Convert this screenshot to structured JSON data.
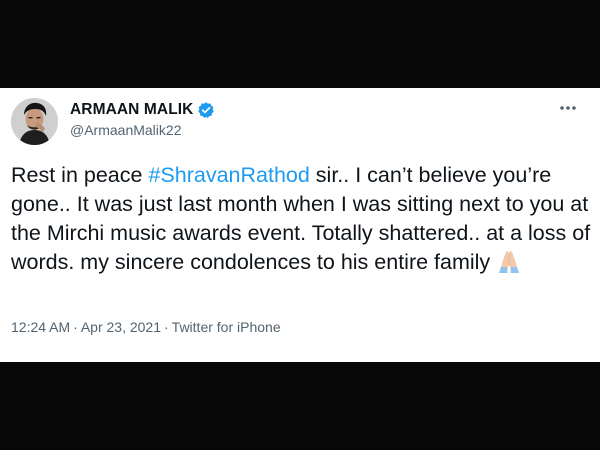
{
  "tweet": {
    "author": {
      "display_name": "ARMAAN MALIK",
      "handle": "@ArmaanMalik22",
      "verified": true
    },
    "more_icon": "more-options-icon",
    "text": {
      "before_hashtag": "Rest in peace ",
      "hashtag": "#ShravanRathod",
      "after_hashtag": " sir.. I can’t believe you’re gone.. It was just last month when I was sitting next to you at the Mirchi music awards event. Totally shattered.. at a loss of words. my sincere condolences to his entire family",
      "emoji": "folded-hands-emoji"
    },
    "meta": {
      "time": "12:24 AM",
      "separator": "·",
      "date": "Apr 23, 2021",
      "source": "Twitter for iPhone"
    }
  },
  "colors": {
    "hashtag": "#1d9bf0",
    "verified_badge": "#1d9bf0",
    "secondary_text": "#536471",
    "primary_text": "#0f1419"
  }
}
